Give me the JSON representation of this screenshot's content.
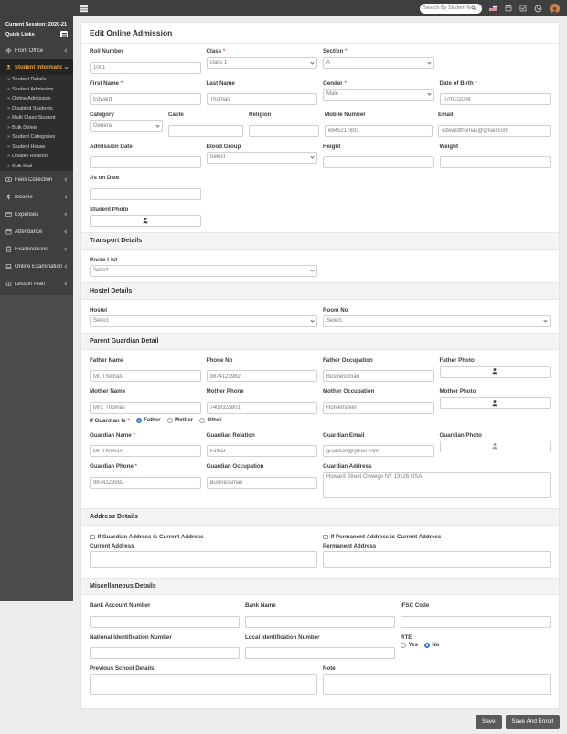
{
  "topbar": {
    "search_placeholder": "Search By Student Name",
    "icons": [
      "magnifier",
      "us-flag",
      "calendar",
      "tasks-check",
      "phone",
      "user-avatar"
    ]
  },
  "sidebar": {
    "session": "Current Session: 2020-21",
    "quick_links": "Quick Links",
    "items": [
      {
        "label": "Front Office",
        "icon": "gear"
      },
      {
        "label": "Student Information",
        "icon": "student",
        "active": true
      },
      {
        "label": "Fees Collection",
        "icon": "cash"
      },
      {
        "label": "Income",
        "icon": "dollar"
      },
      {
        "label": "Expenses",
        "icon": "wallet"
      },
      {
        "label": "Attendance",
        "icon": "calendar"
      },
      {
        "label": "Examinations",
        "icon": "clipboard"
      },
      {
        "label": "Online Examinations",
        "icon": "laptop"
      },
      {
        "label": "Lesson Plan",
        "icon": "book"
      }
    ],
    "subitems": [
      "Student Details",
      "Student Admission",
      "Online Admission",
      "Disabled Students",
      "Multi Class Student",
      "Bulk Delete",
      "Student Categories",
      "Student House",
      "Disable Reason",
      "Bulk Mail"
    ]
  },
  "page": {
    "title": "Edit Online Admission"
  },
  "form": {
    "roll_number": {
      "label": "Roll Number",
      "value": "1001"
    },
    "class": {
      "label": "Class",
      "value": "class 1"
    },
    "section": {
      "label": "Section",
      "value": "A"
    },
    "first_name": {
      "label": "First Name",
      "value": "Edward"
    },
    "last_name": {
      "label": "Last Name",
      "value": "Thomas"
    },
    "gender": {
      "label": "Gender",
      "value": "Male"
    },
    "date_of_birth": {
      "label": "Date of Birth",
      "value": "07/01/2008"
    },
    "category": {
      "label": "Category",
      "value": "General"
    },
    "caste": {
      "label": "Caste",
      "value": ""
    },
    "religion": {
      "label": "Religion",
      "value": ""
    },
    "mobile_number": {
      "label": "Mobile Number",
      "value": "6845217803"
    },
    "email": {
      "label": "Email",
      "value": "edwardthomas@gmail.com"
    },
    "admission_date": {
      "label": "Admission Date",
      "value": ""
    },
    "blood_group": {
      "label": "Blood Group",
      "value": "Select"
    },
    "height": {
      "label": "Height",
      "value": ""
    },
    "weight": {
      "label": "Weight",
      "value": ""
    },
    "as_on_date": {
      "label": "As on Date",
      "value": ""
    },
    "student_photo": {
      "label": "Student Photo"
    }
  },
  "transport": {
    "title": "Transport Details",
    "route_list": {
      "label": "Route List",
      "value": "Select"
    }
  },
  "hostel": {
    "title": "Hostel Details",
    "hostel": {
      "label": "Hostel",
      "value": "Select"
    },
    "room_no": {
      "label": "Room No",
      "value": "Select"
    }
  },
  "guardian": {
    "title": "Parent Guardian Detail",
    "father_name": {
      "label": "Father Name",
      "value": "Mr. Thomas"
    },
    "phone_no": {
      "label": "Phone No",
      "value": "9874123982"
    },
    "father_occupation": {
      "label": "Father Occupation",
      "value": "Businessman"
    },
    "father_photo": {
      "label": "Father Photo"
    },
    "mother_name": {
      "label": "Mother Name",
      "value": "Mrs. Thomas"
    },
    "mother_phone": {
      "label": "Mother Phone",
      "value": "7409325801"
    },
    "mother_occupation": {
      "label": "Mother Occupation",
      "value": "Homemaker"
    },
    "mother_photo": {
      "label": "Mother Photo"
    },
    "if_guardian_is": {
      "label": "If Guardian Is",
      "options": [
        "Father",
        "Mother",
        "Other"
      ],
      "selected": "Father"
    },
    "guardian_name": {
      "label": "Guardian Name",
      "value": "Mr. Thomas"
    },
    "guardian_relation": {
      "label": "Guardian Relation",
      "value": "Father"
    },
    "guardian_email": {
      "label": "Guardian Email",
      "value": "guardian@gmail.com"
    },
    "guardian_photo": {
      "label": "Guardian Photo"
    },
    "guardian_phone": {
      "label": "Guardian Phone",
      "value": "9874123982"
    },
    "guardian_occupation": {
      "label": "Guardian Occupation",
      "value": "Businessman"
    },
    "guardian_address": {
      "label": "Guardian Address",
      "value": "Howard Street Oswego NY 13126 USA"
    }
  },
  "address": {
    "title": "Address Details",
    "guardian_is_current": {
      "label": "If Guardian Address is Current Address",
      "checked": false
    },
    "permanent_is_current": {
      "label": "If Permanent Address is Current Address",
      "checked": false
    },
    "current_address": {
      "label": "Current Address",
      "value": ""
    },
    "permanent_address": {
      "label": "Permanent Address",
      "value": ""
    }
  },
  "misc": {
    "title": "Miscellaneous Details",
    "bank_account_number": {
      "label": "Bank Account Number",
      "value": ""
    },
    "bank_name": {
      "label": "Bank Name",
      "value": ""
    },
    "ifsc_code": {
      "label": "IFSC Code",
      "value": ""
    },
    "national_id": {
      "label": "National Identification Number",
      "value": ""
    },
    "local_id": {
      "label": "Local Identification Number",
      "value": ""
    },
    "rte": {
      "label": "RTE",
      "options": [
        "Yes",
        "No"
      ],
      "selected": "No"
    },
    "previous_school": {
      "label": "Previous School Details",
      "value": ""
    },
    "note": {
      "label": "Note",
      "value": ""
    }
  },
  "footer": {
    "save": "Save",
    "save_and_enroll": "Save And Enroll"
  },
  "colors": {
    "accent_orange": "#eda13c",
    "sidebar_dark": "#3f3f3f",
    "radio_blue": "#2f7bd9",
    "button_gray": "#5a5a5a"
  }
}
